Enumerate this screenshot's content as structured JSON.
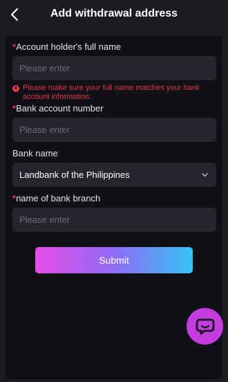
{
  "header": {
    "title": "Add withdrawal address",
    "back_icon": "chevron-left-icon"
  },
  "form": {
    "required_mark": "*",
    "holder_name": {
      "label": "Account holder's full name",
      "placeholder": "Please enter",
      "value": ""
    },
    "warning": {
      "icon": "alert-circle-icon",
      "text": "Please make sure your full name matches your bank account information."
    },
    "account_number": {
      "label": "Bank account number",
      "placeholder": "Please enter",
      "value": ""
    },
    "bank_name": {
      "label": "Bank name",
      "selected": "Landbank of the Philippines",
      "icon": "chevron-down-icon"
    },
    "branch": {
      "label": "name of bank branch",
      "placeholder": "Please enter",
      "value": ""
    },
    "submit_label": "Submit"
  },
  "chat_button": {
    "icon": "chat-bubble-icon"
  },
  "colors": {
    "background": "#1b1c22",
    "card": "#101116",
    "input": "#25262d",
    "required": "#e5344b",
    "gradient_start": "#e64de6",
    "gradient_end": "#37c3f5",
    "chat_fab": "#c53be0"
  }
}
